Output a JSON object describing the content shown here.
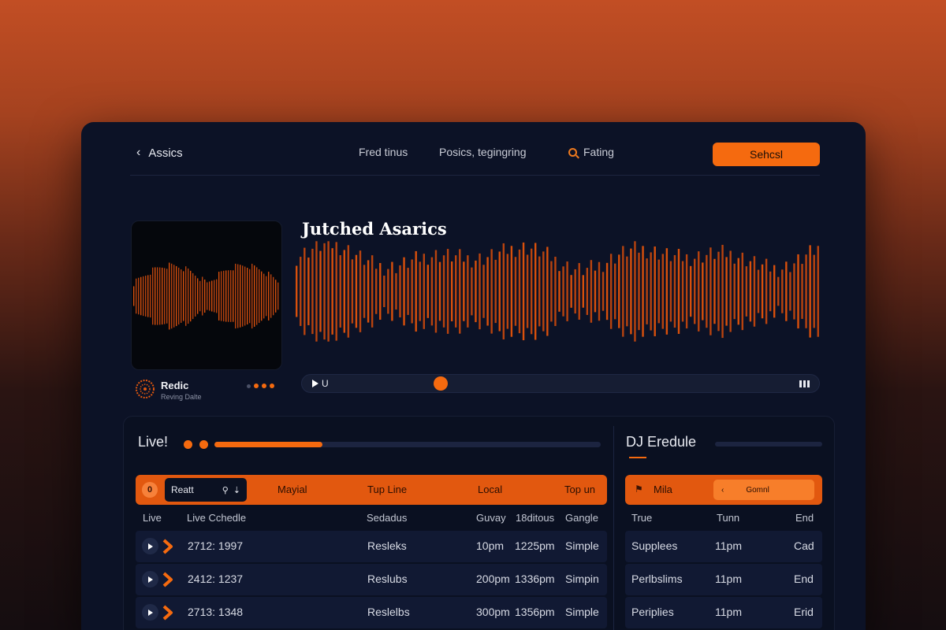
{
  "header": {
    "back_label": "Assics",
    "nav": [
      "Fred tinus",
      "Posics, tegingring",
      "Fating"
    ],
    "primary_button": "Sehcsl"
  },
  "player": {
    "title": "Jutched Asarics",
    "artist": "Redic",
    "artist_sub": "Reving Dalte",
    "time": "U",
    "progress": 0.27
  },
  "live": {
    "title": "Live!",
    "progress": 0.28,
    "header": {
      "icon_glyph": "0",
      "search_value": "Reatt",
      "labels": [
        "Mayial",
        "Tup Line",
        "Local",
        "Top un"
      ]
    },
    "columns": [
      "Live",
      "Live Cchedle",
      "Sedadus",
      "Guvay",
      "18ditous",
      "Gangle"
    ],
    "rows": [
      {
        "code": "2712: 1997",
        "name": "Resleks",
        "start": "10pm",
        "end": "1225pm",
        "type": "Simple"
      },
      {
        "code": "2412: 1237",
        "name": "Reslubs",
        "start": "200pm",
        "end": "1336pm",
        "type": "Simpin"
      },
      {
        "code": "2713: 1348",
        "name": "Reslelbs",
        "start": "300pm",
        "end": "1356pm",
        "type": "Simple"
      }
    ]
  },
  "dj": {
    "title": "DJ Eredule",
    "header": {
      "label": "Mila",
      "button_arrow": "‹",
      "button_label": "Gomnl"
    },
    "columns": [
      "True",
      "Tunn",
      "End"
    ],
    "rows": [
      {
        "name": "Supplees",
        "time": "11pm",
        "end": "Cad"
      },
      {
        "name": "Perlbslims",
        "time": "11pm",
        "end": "End"
      },
      {
        "name": "Periplies",
        "time": "11pm",
        "end": "Erid"
      }
    ]
  },
  "colors": {
    "accent": "#f56a0f",
    "panel": "#0c1226"
  }
}
